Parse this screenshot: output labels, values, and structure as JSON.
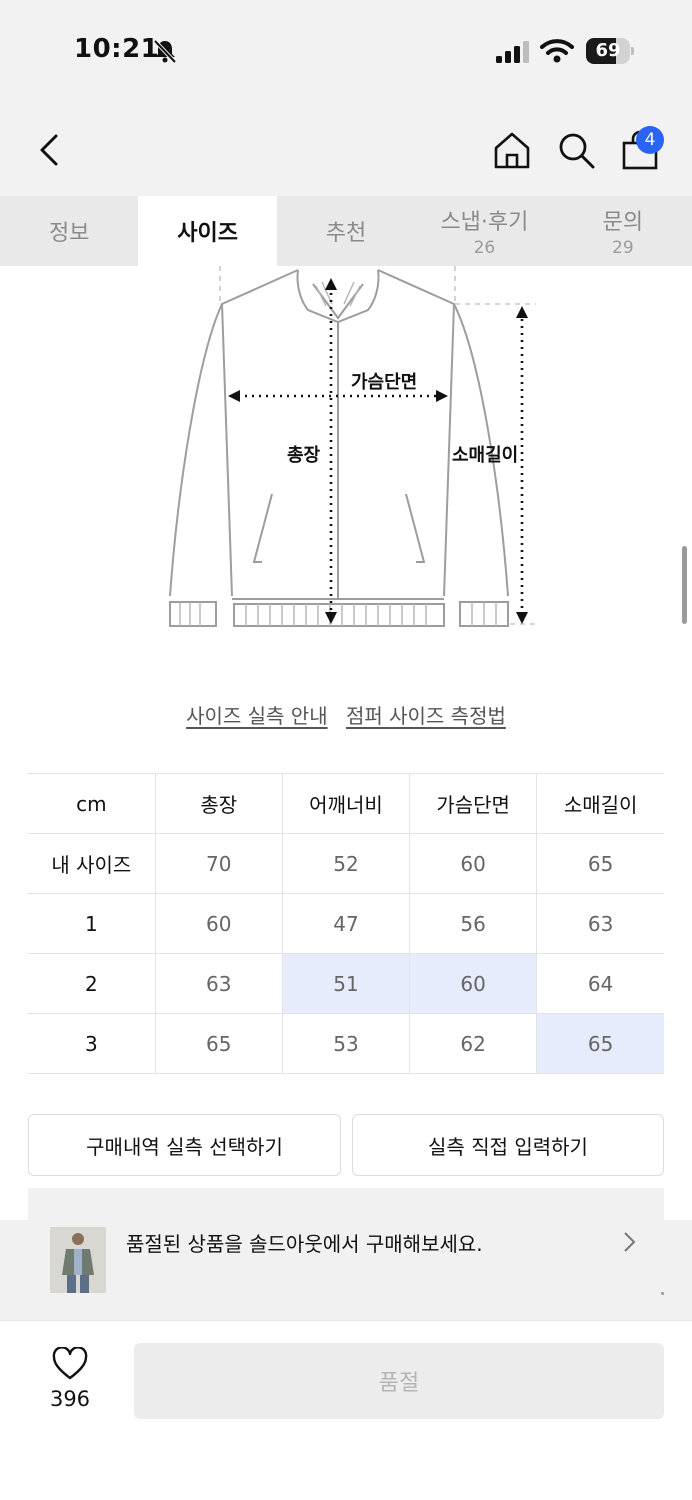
{
  "status_bar": {
    "time": "10:21",
    "battery": "69",
    "battery_level": 0.69
  },
  "nav": {
    "cart_count": "4"
  },
  "tabs": [
    {
      "label": "정보",
      "count": ""
    },
    {
      "label": "사이즈",
      "count": ""
    },
    {
      "label": "추천",
      "count": ""
    },
    {
      "label": "스냅·후기",
      "count": "26"
    },
    {
      "label": "문의",
      "count": "29"
    }
  ],
  "active_tab": "사이즈",
  "diagram": {
    "chest_label": "가슴단면",
    "length_label": "총장",
    "sleeve_label": "소매길이"
  },
  "links": {
    "size_guide": "사이즈 실측 안내",
    "jumper_measure": "점퍼 사이즈 측정법"
  },
  "size_table": {
    "headers": [
      "cm",
      "총장",
      "어깨너비",
      "가슴단면",
      "소매길이"
    ],
    "rows": [
      {
        "label": "내 사이즈",
        "values": [
          "70",
          "52",
          "60",
          "65"
        ]
      },
      {
        "label": "1",
        "values": [
          "60",
          "47",
          "56",
          "63"
        ]
      },
      {
        "label": "2",
        "values": [
          "63",
          "51",
          "60",
          "64"
        ]
      },
      {
        "label": "3",
        "values": [
          "65",
          "53",
          "62",
          "65"
        ]
      }
    ]
  },
  "buttons": {
    "purchase_history": "구매내역 실측 선택하기",
    "direct_input": "실측 직접 입력하기"
  },
  "banner": {
    "text": "품절된 상품을 솔드아웃에서 구매해보세요."
  },
  "bottom": {
    "like_count": "396",
    "soldout_label": "품절"
  },
  "colors": {
    "accent": "#2a64f6",
    "highlight": "#e6ecfb"
  }
}
